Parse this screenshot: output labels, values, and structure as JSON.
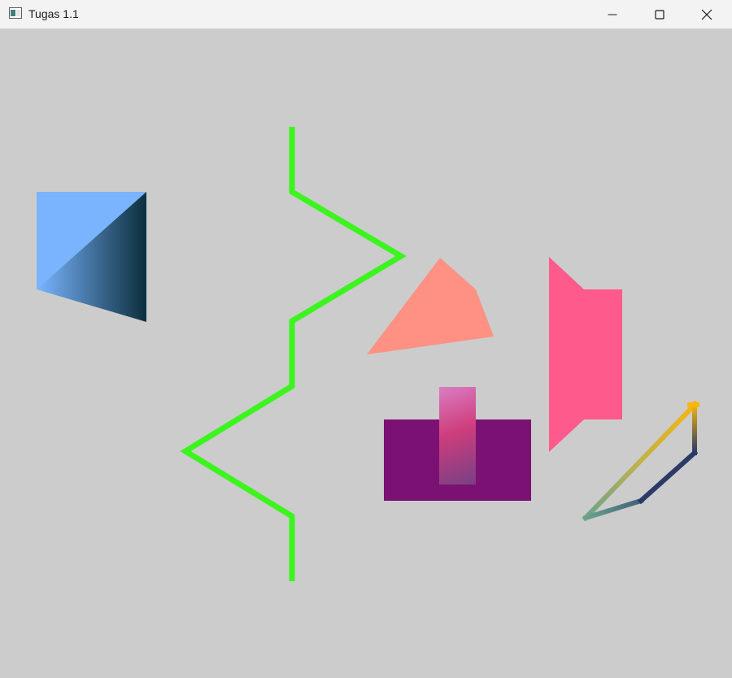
{
  "window": {
    "title": "Tugas 1.1",
    "icon": "window-app-icon",
    "controls": [
      "minimize-icon",
      "maximize-icon",
      "close-icon"
    ]
  },
  "canvas": {
    "background": "#cccccc",
    "shapes": [
      {
        "name": "blue-gradient-quad",
        "colors": [
          "#7ab4ff",
          "#0c2f3d"
        ]
      },
      {
        "name": "green-zigzag-line",
        "color": "#3cf41e"
      },
      {
        "name": "salmon-polygon",
        "color": "#ff9184"
      },
      {
        "name": "pink-polygon",
        "color": "#ff5a8c"
      },
      {
        "name": "purple-rectangle",
        "color": "#7b1173"
      },
      {
        "name": "gradient-bar",
        "colors": [
          "#d97cc2",
          "#cf3e7c",
          "#7a3f86"
        ]
      },
      {
        "name": "gradient-outline-quad",
        "colors": [
          "#f6b70a",
          "#6aa38b",
          "#2b3a66"
        ]
      }
    ]
  }
}
